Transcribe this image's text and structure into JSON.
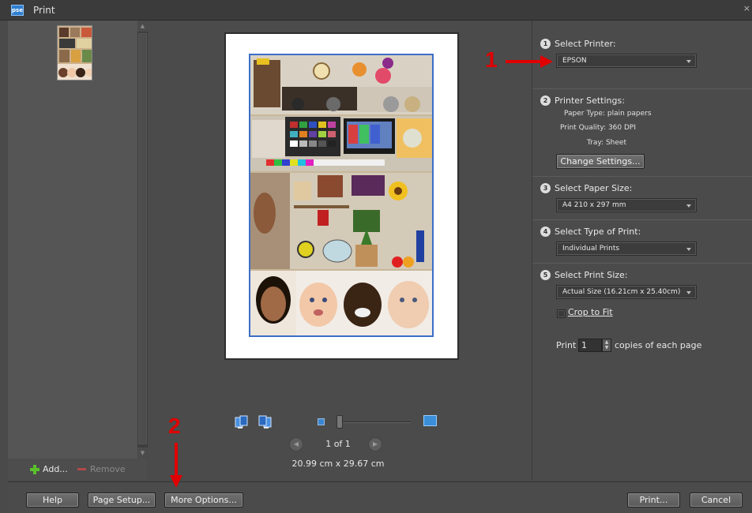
{
  "window": {
    "title": "Print",
    "icon_text": "pse",
    "close_glyph": "×"
  },
  "left_panel": {
    "add_label": "Add...",
    "remove_label": "Remove"
  },
  "preview": {
    "page_count": "1 of 1",
    "paper_dimensions": "20.99 cm x 29.67 cm",
    "prev_glyph": "◀",
    "next_glyph": "▶"
  },
  "settings": {
    "select_printer": {
      "number": "1",
      "label": "Select Printer:",
      "value": "EPSON"
    },
    "printer_settings": {
      "number": "2",
      "label": "Printer Settings:",
      "paper_type": "Paper Type: plain papers",
      "print_quality": "Print Quality: 360 DPI",
      "tray": "Tray: Sheet",
      "change_button": "Change Settings..."
    },
    "paper_size": {
      "number": "3",
      "label": "Select Paper Size:",
      "value": "A4 210 x 297 mm"
    },
    "type_of_print": {
      "number": "4",
      "label": "Select Type of Print:",
      "value": "Individual Prints"
    },
    "print_size": {
      "number": "5",
      "label": "Select Print Size:",
      "value": "Actual Size (16.21cm x 25.40cm)",
      "crop_to_fit": "Crop to Fit",
      "crop_checked": false
    },
    "copies": {
      "prefix": "Print",
      "value": "1",
      "suffix": "copies of each page"
    }
  },
  "buttons": {
    "help": "Help",
    "page_setup": "Page Setup...",
    "more_options": "More Options...",
    "print": "Print...",
    "cancel": "Cancel"
  },
  "annotations": {
    "one": "1",
    "two": "2",
    "color": "#e00000"
  },
  "colors": {
    "panel": "#4b4b4b",
    "accent_blue": "#3b6fc7"
  }
}
